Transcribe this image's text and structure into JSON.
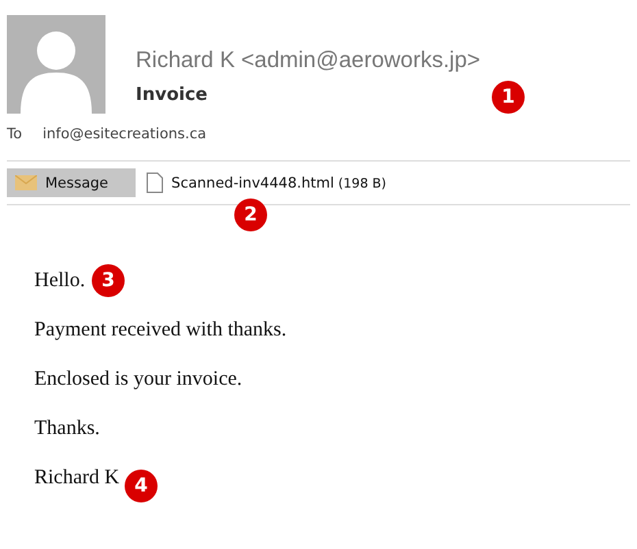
{
  "sender": "Richard K <admin@aeroworks.jp>",
  "subject": "Invoice",
  "to": {
    "label": "To",
    "address": "info@esitecreations.ca"
  },
  "tabs": [
    {
      "label": "Message",
      "selected": true
    },
    {
      "label": "Scanned-inv4448.html",
      "size": "(198 B)",
      "selected": false
    }
  ],
  "body": [
    "Hello.",
    "Payment received with thanks.",
    "Enclosed is your invoice.",
    "Thanks.",
    "Richard K"
  ],
  "markers": [
    "1",
    "2",
    "3",
    "4"
  ]
}
